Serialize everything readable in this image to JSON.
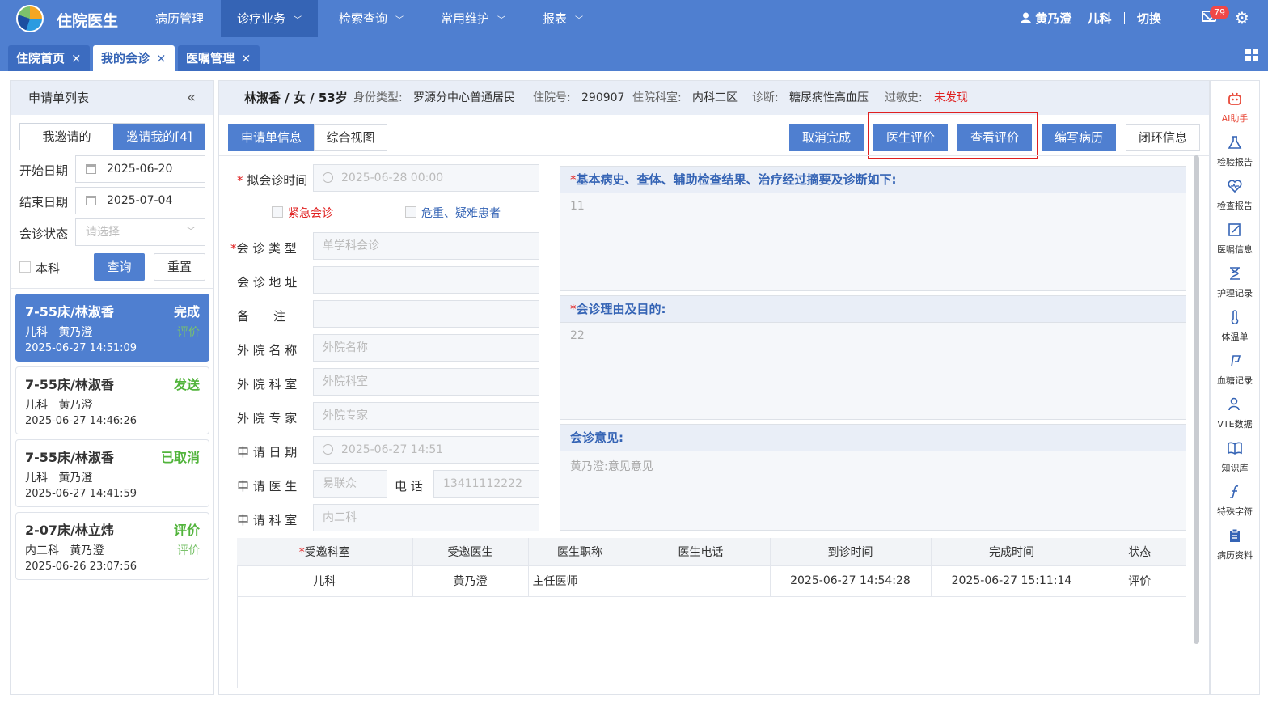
{
  "header": {
    "app_title": "住院医生",
    "nav": [
      {
        "label": "病历管理",
        "chevron": ""
      },
      {
        "label": "诊疗业务",
        "chevron": "﹀"
      },
      {
        "label": "检索查询",
        "chevron": "﹀"
      },
      {
        "label": "常用维护",
        "chevron": "﹀"
      },
      {
        "label": "报表",
        "chevron": "﹀"
      }
    ],
    "user_name": "黄乃澄",
    "department": "儿科",
    "switch_label": "切换",
    "mail_count": "79",
    "icons": {
      "logo": "hospital-logo",
      "mail": "mail-icon",
      "settings": "gear-icon",
      "user": "user-icon"
    }
  },
  "tabs": [
    {
      "label": "住院首页",
      "close": "×"
    },
    {
      "label": "我的会诊",
      "close": "×"
    },
    {
      "label": "医嘱管理",
      "close": "×"
    }
  ],
  "left": {
    "title": "申请单列表",
    "collapse": "«",
    "seg_mine": "我邀请的",
    "seg_invited": "邀请我的[4]",
    "start_label": "开始日期",
    "start_value": "2025-06-20",
    "end_label": "结束日期",
    "end_value": "2025-07-04",
    "status_label": "会诊状态",
    "status_placeholder": "请选择",
    "dept_check": "本科",
    "query_btn": "查询",
    "reset_btn": "重置",
    "cards": [
      {
        "title": "7-55床/林淑香",
        "status": "完成",
        "dept": "儿科",
        "doctor": "黄乃澄",
        "eval": "评价",
        "time": "2025-06-27 14:51:09"
      },
      {
        "title": "7-55床/林淑香",
        "status": "发送",
        "dept": "儿科",
        "doctor": "黄乃澄",
        "eval": "",
        "time": "2025-06-27 14:46:26"
      },
      {
        "title": "7-55床/林淑香",
        "status": "已取消",
        "dept": "儿科",
        "doctor": "黄乃澄",
        "eval": "",
        "time": "2025-06-27 14:41:59"
      },
      {
        "title": "2-07床/林立炜",
        "status": "评价",
        "dept": "内二科",
        "doctor": "黄乃澄",
        "eval": "评价",
        "time": "2025-06-26 23:07:56"
      }
    ]
  },
  "patient": {
    "name": "林淑香 / 女 / 53岁",
    "id_type_label": "身份类型:",
    "id_type": "罗源分中心普通居民",
    "adm_no_label": "住院号:",
    "adm_no": "290907",
    "dept_label": "住院科室:",
    "dept": "内科二区",
    "diag_label": "诊断:",
    "diag": "糖尿病性高血压",
    "allergy_label": "过敏史:",
    "allergy": "未发现"
  },
  "view_tabs": [
    "申请单信息",
    "综合视图"
  ],
  "actions": [
    "取消完成",
    "医生评价",
    "查看评价",
    "编写病历",
    "闭环信息"
  ],
  "form": {
    "time_label": "拟会诊时间",
    "time_value": "2025-06-28 00:00",
    "urgent": "紧急会诊",
    "critical": "危重、疑难患者",
    "type_label": "会 诊 类 型",
    "type_value": "单学科会诊",
    "addr_label": "会 诊 地 址",
    "remark_label": "备　　注",
    "hosp_label": "外 院 名 称",
    "hosp_ph": "外院名称",
    "hdept_label": "外 院 科 室",
    "hdept_ph": "外院科室",
    "expert_label": "外 院 专 家",
    "expert_ph": "外院专家",
    "apply_date_label": "申 请 日 期",
    "apply_date": "2025-06-27 14:51",
    "apply_doc_label": "申 请 医 生",
    "apply_doc": "易联众",
    "phone_label": "电 话",
    "phone": "13411112222",
    "apply_dept_label": "申 请 科 室",
    "apply_dept": "内二科"
  },
  "sections": {
    "history_title": "基本病史、查体、辅助检查结果、治疗经过摘要及诊断如下:",
    "history_body": "11",
    "reason_title": "会诊理由及目的:",
    "reason_body": "22",
    "opinion_title": "会诊意见:",
    "opinion_body": "黄乃澄:意见意见"
  },
  "table": {
    "headers": [
      "受邀科室",
      "受邀医生",
      "医生职称",
      "医生电话",
      "到诊时间",
      "完成时间",
      "状态"
    ],
    "rows": [
      [
        "儿科",
        "黄乃澄",
        "主任医师",
        "",
        "2025-06-27 14:54:28",
        "2025-06-27 15:11:14",
        "评价"
      ]
    ]
  },
  "right_bar": [
    {
      "label": "AI助手",
      "icon": "ai-assistant-icon"
    },
    {
      "label": "检验报告",
      "icon": "flask-icon"
    },
    {
      "label": "检查报告",
      "icon": "heart-icon"
    },
    {
      "label": "医嘱信息",
      "icon": "edit-icon"
    },
    {
      "label": "护理记录",
      "icon": "hourglass-icon"
    },
    {
      "label": "体温单",
      "icon": "thermometer-icon"
    },
    {
      "label": "血糖记录",
      "icon": "blood-sugar-icon"
    },
    {
      "label": "VTE数据",
      "icon": "user-check-icon"
    },
    {
      "label": "知识库",
      "icon": "book-icon"
    },
    {
      "label": "特殊字符",
      "icon": "function-icon"
    },
    {
      "label": "病历资料",
      "icon": "clipboard-icon"
    }
  ],
  "colors": {
    "brand": "#4f7fd0",
    "nav_active": "#3564b5",
    "danger": "#e02020",
    "success": "#52b43c"
  }
}
